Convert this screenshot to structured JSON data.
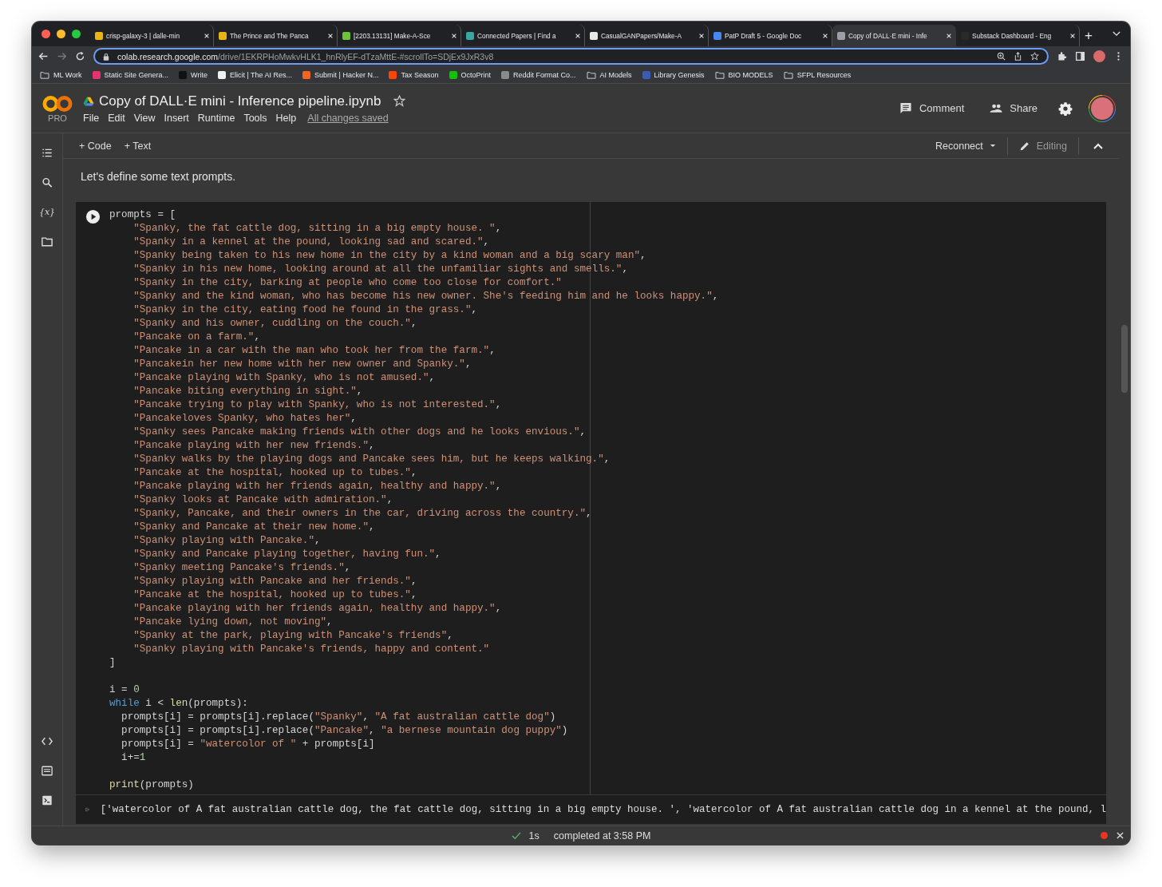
{
  "browser": {
    "tabs": [
      {
        "title": "crisp-galaxy-3 | dalle-min",
        "color": "#e8b516",
        "selected": false
      },
      {
        "title": "The Prince and The Panca",
        "color": "#e8b516",
        "selected": false
      },
      {
        "title": "[2203.13131] Make-A-Sce",
        "color": "#6cc33a",
        "selected": false
      },
      {
        "title": "Connected Papers | Find a",
        "color": "#3aa6a0",
        "selected": false
      },
      {
        "title": "CasualGANPapers/Make-A",
        "color": "#e8e8e8",
        "selected": false
      },
      {
        "title": "PatP Draft 5 - Google Doc",
        "color": "#4a86f0",
        "selected": false
      },
      {
        "title": "Copy of DALL·E mini - Infe",
        "color": "#9aa0a6",
        "selected": true
      },
      {
        "title": "Substack Dashboard - Eng",
        "color": "#2a2a2a",
        "selected": false
      }
    ],
    "new_tab": "+",
    "url_host": "colab.research.google.com",
    "url_path": "/drive/1EKRPHoMwkvHLK1_hnRlyEF-dTzaMttE-#scrollTo=SDjEx9JxR3v8",
    "bookmarks": [
      {
        "label": "ML Work",
        "kind": "folder"
      },
      {
        "label": "Static Site Genera...",
        "kind": "site",
        "color": "#e6336f"
      },
      {
        "label": "Write",
        "kind": "site",
        "color": "#111111"
      },
      {
        "label": "Elicit | The AI Res...",
        "kind": "site",
        "color": "#f1f1f1"
      },
      {
        "label": "Submit | Hacker N...",
        "kind": "site",
        "color": "#f26522"
      },
      {
        "label": "Tax Season",
        "kind": "site",
        "color": "#ff4500"
      },
      {
        "label": "OctoPrint",
        "kind": "site",
        "color": "#13c100"
      },
      {
        "label": "Reddit Format Co...",
        "kind": "site",
        "color": "#8a8a8a"
      },
      {
        "label": "AI Models",
        "kind": "folder"
      },
      {
        "label": "Library Genesis",
        "kind": "site",
        "color": "#3b5bb5"
      },
      {
        "label": "BIO MODELS",
        "kind": "folder"
      },
      {
        "label": "SFPL Resources",
        "kind": "folder"
      }
    ]
  },
  "colab": {
    "badge": "PRO",
    "title": "Copy of DALL·E mini - Inference pipeline.ipynb",
    "menu": [
      "File",
      "Edit",
      "View",
      "Insert",
      "Runtime",
      "Tools",
      "Help"
    ],
    "save_status": "All changes saved",
    "comment": "Comment",
    "share": "Share",
    "toolbar": {
      "add_code": "+ Code",
      "add_text": "+ Text",
      "runtime": "Reconnect",
      "mode": "Editing"
    },
    "sidebar_var": "{x}",
    "markdown": "Let's define some text prompts.",
    "code_blocks": [
      [
        {
          "segments": [
            {
              "kind": "plain",
              "text": "prompts = ["
            }
          ],
          "children": [
            {
              "segments": [
                {
                  "kind": "string",
                  "text": "\"Spanky, the fat cattle dog, sitting in a big empty house. \""
                },
                {
                  "kind": "plain",
                  "text": ","
                }
              ]
            },
            {
              "segments": [
                {
                  "kind": "string",
                  "text": "\"Spanky in a kennel at the pound, looking sad and scared.\""
                },
                {
                  "kind": "plain",
                  "text": ","
                }
              ]
            },
            {
              "segments": [
                {
                  "kind": "string",
                  "text": "\"Spanky being taken to his new home in the city by a kind woman and a big scary man\""
                },
                {
                  "kind": "plain",
                  "text": ","
                }
              ]
            },
            {
              "segments": [
                {
                  "kind": "string",
                  "text": "\"Spanky in his new home, looking around at all the unfamiliar sights and smells.\""
                },
                {
                  "kind": "plain",
                  "text": ","
                }
              ]
            },
            {
              "segments": [
                {
                  "kind": "string",
                  "text": "\"Spanky in the city, barking at people who come too close for comfort.\""
                }
              ]
            },
            {
              "segments": [
                {
                  "kind": "string",
                  "text": "\"Spanky and the kind woman, who has become his new owner. She's feeding him and he looks happy.\""
                },
                {
                  "kind": "plain",
                  "text": ","
                }
              ]
            },
            {
              "segments": [
                {
                  "kind": "string",
                  "text": "\"Spanky in the city, eating food he found in the grass.\""
                },
                {
                  "kind": "plain",
                  "text": ","
                }
              ]
            },
            {
              "segments": [
                {
                  "kind": "string",
                  "text": "\"Spanky and his owner, cuddling on the couch.\""
                },
                {
                  "kind": "plain",
                  "text": ","
                }
              ]
            },
            {
              "segments": [
                {
                  "kind": "string",
                  "text": "\"Pancake on a farm.\""
                },
                {
                  "kind": "plain",
                  "text": ","
                }
              ]
            },
            {
              "segments": [
                {
                  "kind": "string",
                  "text": "\"Pancake in a car with the man who took her from the farm.\""
                },
                {
                  "kind": "plain",
                  "text": ","
                }
              ]
            },
            {
              "segments": [
                {
                  "kind": "string",
                  "text": "\"Pancakein her new home with her new owner and Spanky.\""
                },
                {
                  "kind": "plain",
                  "text": ","
                }
              ]
            },
            {
              "segments": [
                {
                  "kind": "string",
                  "text": "\"Pancake playing with Spanky, who is not amused.\""
                },
                {
                  "kind": "plain",
                  "text": ","
                }
              ]
            },
            {
              "segments": [
                {
                  "kind": "string",
                  "text": "\"Pancake biting everything in sight.\""
                },
                {
                  "kind": "plain",
                  "text": ","
                }
              ]
            },
            {
              "segments": [
                {
                  "kind": "string",
                  "text": "\"Pancake trying to play with Spanky, who is not interested.\""
                },
                {
                  "kind": "plain",
                  "text": ","
                }
              ]
            },
            {
              "segments": [
                {
                  "kind": "string",
                  "text": "\"Pancakeloves Spanky, who hates her\""
                },
                {
                  "kind": "plain",
                  "text": ","
                }
              ]
            },
            {
              "segments": [
                {
                  "kind": "string",
                  "text": "\"Spanky sees Pancake making friends with other dogs and he looks envious.\""
                },
                {
                  "kind": "plain",
                  "text": ","
                }
              ]
            },
            {
              "segments": [
                {
                  "kind": "string",
                  "text": "\"Pancake playing with her new friends.\""
                },
                {
                  "kind": "plain",
                  "text": ","
                }
              ]
            },
            {
              "segments": [
                {
                  "kind": "string",
                  "text": "\"Spanky walks by the playing dogs and Pancake sees him, but he keeps walking.\""
                },
                {
                  "kind": "plain",
                  "text": ","
                }
              ]
            },
            {
              "segments": [
                {
                  "kind": "string",
                  "text": "\"Pancake at the hospital, hooked up to tubes.\""
                },
                {
                  "kind": "plain",
                  "text": ","
                }
              ]
            },
            {
              "segments": [
                {
                  "kind": "string",
                  "text": "\"Pancake playing with her friends again, healthy and happy.\""
                },
                {
                  "kind": "plain",
                  "text": ","
                }
              ]
            },
            {
              "segments": [
                {
                  "kind": "string",
                  "text": "\"Spanky looks at Pancake with admiration.\""
                },
                {
                  "kind": "plain",
                  "text": ","
                }
              ]
            },
            {
              "segments": [
                {
                  "kind": "string",
                  "text": "\"Spanky, Pancake, and their owners in the car, driving across the country.\""
                },
                {
                  "kind": "plain",
                  "text": ","
                }
              ]
            },
            {
              "segments": [
                {
                  "kind": "string",
                  "text": "\"Spanky and Pancake at their new home.\""
                },
                {
                  "kind": "plain",
                  "text": ","
                }
              ]
            },
            {
              "segments": [
                {
                  "kind": "string",
                  "text": "\"Spanky playing with Pancake.\""
                },
                {
                  "kind": "plain",
                  "text": ","
                }
              ]
            },
            {
              "segments": [
                {
                  "kind": "string",
                  "text": "\"Spanky and Pancake playing together, having fun.\""
                },
                {
                  "kind": "plain",
                  "text": ","
                }
              ]
            },
            {
              "segments": [
                {
                  "kind": "string",
                  "text": "\"Spanky meeting Pancake's friends.\""
                },
                {
                  "kind": "plain",
                  "text": ","
                }
              ]
            },
            {
              "segments": [
                {
                  "kind": "string",
                  "text": "\"Spanky playing with Pancake and her friends.\""
                },
                {
                  "kind": "plain",
                  "text": ","
                }
              ]
            },
            {
              "segments": [
                {
                  "kind": "string",
                  "text": "\"Pancake at the hospital, hooked up to tubes.\""
                },
                {
                  "kind": "plain",
                  "text": ","
                }
              ]
            },
            {
              "segments": [
                {
                  "kind": "string",
                  "text": "\"Pancake playing with her friends again, healthy and happy.\""
                },
                {
                  "kind": "plain",
                  "text": ","
                }
              ]
            },
            {
              "segments": [
                {
                  "kind": "string",
                  "text": "\"Pancake lying down, not moving\""
                },
                {
                  "kind": "plain",
                  "text": ","
                }
              ]
            },
            {
              "segments": [
                {
                  "kind": "string",
                  "text": "\"Spanky at the park, playing with Pancake's friends\""
                },
                {
                  "kind": "plain",
                  "text": ","
                }
              ]
            },
            {
              "segments": [
                {
                  "kind": "string",
                  "text": "\"Spanky playing with Pancake's friends, happy and content.\""
                }
              ]
            }
          ]
        },
        {
          "segments": [
            {
              "kind": "plain",
              "text": "]"
            }
          ]
        }
      ],
      [
        {
          "segments": [
            {
              "kind": "plain",
              "text": "i = "
            },
            {
              "kind": "number",
              "text": "0"
            }
          ]
        },
        {
          "segments": [
            {
              "kind": "keyword",
              "text": "while"
            },
            {
              "kind": "plain",
              "text": " i < "
            },
            {
              "kind": "builtin",
              "text": "len"
            },
            {
              "kind": "plain",
              "text": "(prompts):"
            }
          ]
        },
        {
          "segments": [
            {
              "kind": "plain",
              "text": "  prompts[i] = prompts[i].replace("
            },
            {
              "kind": "string",
              "text": "\"Spanky\""
            },
            {
              "kind": "plain",
              "text": ", "
            },
            {
              "kind": "string",
              "text": "\"A fat australian cattle dog\""
            },
            {
              "kind": "plain",
              "text": ")"
            }
          ]
        },
        {
          "segments": [
            {
              "kind": "plain",
              "text": "  prompts[i] = prompts[i].replace("
            },
            {
              "kind": "string",
              "text": "\"Pancake\""
            },
            {
              "kind": "plain",
              "text": ", "
            },
            {
              "kind": "string",
              "text": "\"a bernese mountain dog puppy\""
            },
            {
              "kind": "plain",
              "text": ")"
            }
          ]
        },
        {
          "segments": [
            {
              "kind": "plain",
              "text": "  prompts[i] = "
            },
            {
              "kind": "string",
              "text": "\"watercolor of \""
            },
            {
              "kind": "plain",
              "text": " + prompts[i]"
            }
          ]
        },
        {
          "segments": [
            {
              "kind": "plain",
              "text": "  i+="
            },
            {
              "kind": "number",
              "text": "1"
            }
          ]
        }
      ],
      [
        {
          "segments": [
            {
              "kind": "builtin",
              "text": "print"
            },
            {
              "kind": "plain",
              "text": "(prompts)"
            }
          ]
        }
      ]
    ],
    "output": "['watercolor of A fat australian cattle dog, the fat cattle dog, sitting in a big empty house. ', 'watercolor of A fat australian cattle dog in a kennel at the pound, l",
    "status": {
      "duration": "1s",
      "message": "completed at 3:58 PM"
    }
  }
}
